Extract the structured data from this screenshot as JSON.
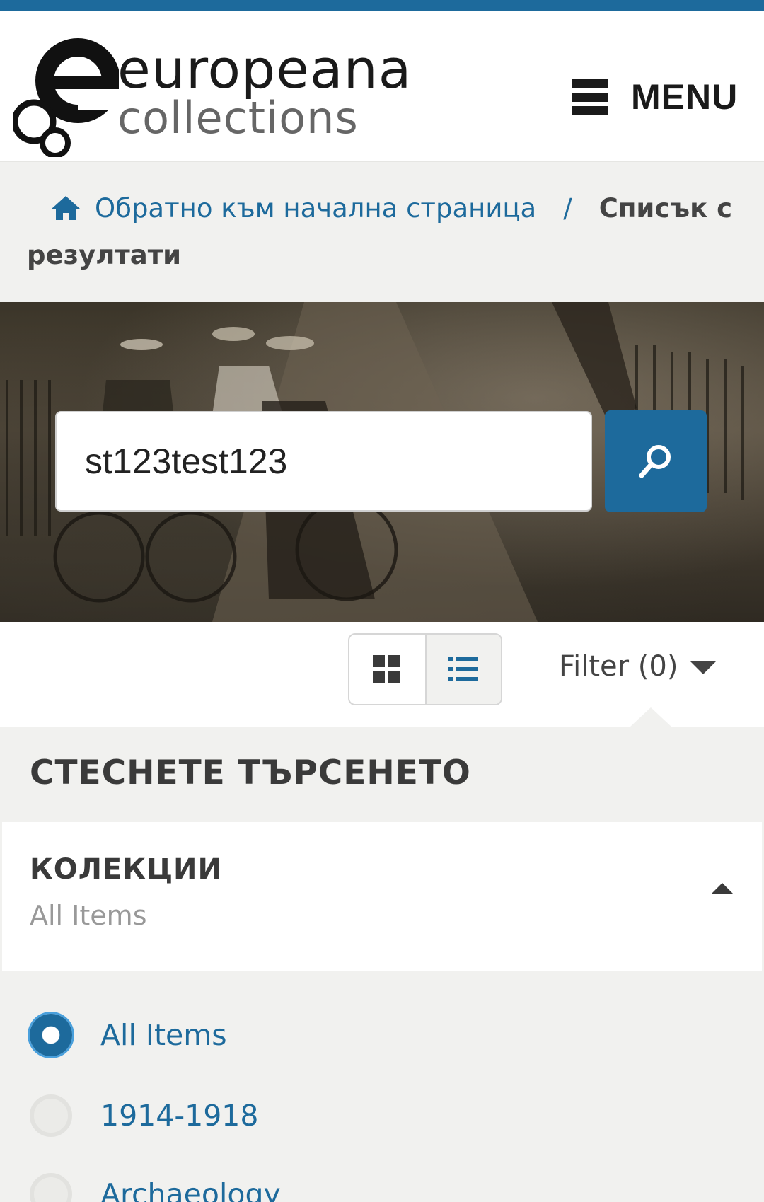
{
  "header": {
    "logo_word1": "europeana",
    "logo_word2": "collections",
    "menu_label": "MENU"
  },
  "breadcrumb": {
    "home_label": "Обратно към начална страница",
    "separator": "/",
    "current": "Списък с резултати"
  },
  "search": {
    "value": "st123test123",
    "button_icon": "search-icon"
  },
  "toolbar": {
    "grid_icon": "grid-view-icon",
    "list_icon": "list-view-icon",
    "active_view": "list",
    "filter_label": "Filter (0)"
  },
  "refine": {
    "title": "СТЕСНЕТЕ ТЪРСЕНЕТО",
    "panel_title": "КОЛЕКЦИИ",
    "panel_selected": "All Items",
    "options": [
      {
        "label": "All Items",
        "selected": true
      },
      {
        "label": "1914-1918",
        "selected": false
      },
      {
        "label": "Archaeology",
        "selected": false
      }
    ]
  },
  "colors": {
    "accent": "#1d6a9c",
    "background": "#f1f1ef"
  }
}
